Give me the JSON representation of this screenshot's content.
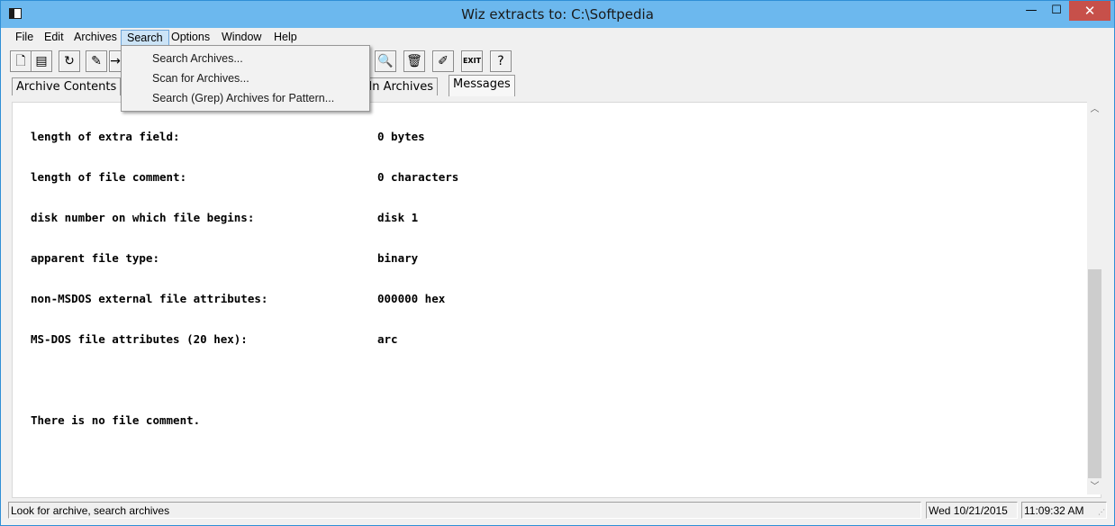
{
  "window": {
    "title": "Wiz extracts to: C:\\Softpedia",
    "minimize_glyph": "—",
    "maximize_glyph": "☐",
    "close_glyph": "✕"
  },
  "menubar": {
    "items": [
      "File",
      "Edit",
      "Archives",
      "Search",
      "Options",
      "Window",
      "Help"
    ]
  },
  "toolbar": {
    "buttons": [
      {
        "icon": "new-file-icon",
        "glyph": "🗋"
      },
      {
        "icon": "open-archive-icon",
        "glyph": "▤"
      },
      {
        "icon": "extract-icon",
        "glyph": "↻"
      },
      {
        "icon": "extract-dir-icon",
        "glyph": "✎"
      },
      {
        "icon": "move-icon",
        "glyph": "→"
      },
      {
        "icon": "search-icon",
        "glyph": "🔍"
      },
      {
        "icon": "trash-icon",
        "glyph": "🗑"
      },
      {
        "icon": "edit-icon",
        "glyph": "✐"
      },
      {
        "icon": "exit-icon",
        "glyph": "EXIT"
      },
      {
        "icon": "help-icon",
        "glyph": "?"
      }
    ]
  },
  "tabs": [
    "Archive Contents",
    "n In Archives",
    "Messages"
  ],
  "search_menu": {
    "items": [
      "Search Archives...",
      "Scan for Archives...",
      "Search (Grep) Archives for Pattern..."
    ]
  },
  "messages": {
    "rows": [
      {
        "key": "length of extra field:",
        "value": "0 bytes"
      },
      {
        "key": "length of file comment:",
        "value": "0 characters"
      },
      {
        "key": "disk number on which file begins:",
        "value": "disk 1"
      },
      {
        "key": "apparent file type:",
        "value": "binary"
      },
      {
        "key": "non-MSDOS external file attributes:",
        "value": "000000 hex"
      },
      {
        "key": "MS-DOS file attributes (20 hex):",
        "value": "arc"
      }
    ],
    "comment": "There is no file comment."
  },
  "statusbar": {
    "message": "Look for archive, search archives",
    "date": "Wed 10/21/2015",
    "time": "11:09:32 AM"
  }
}
